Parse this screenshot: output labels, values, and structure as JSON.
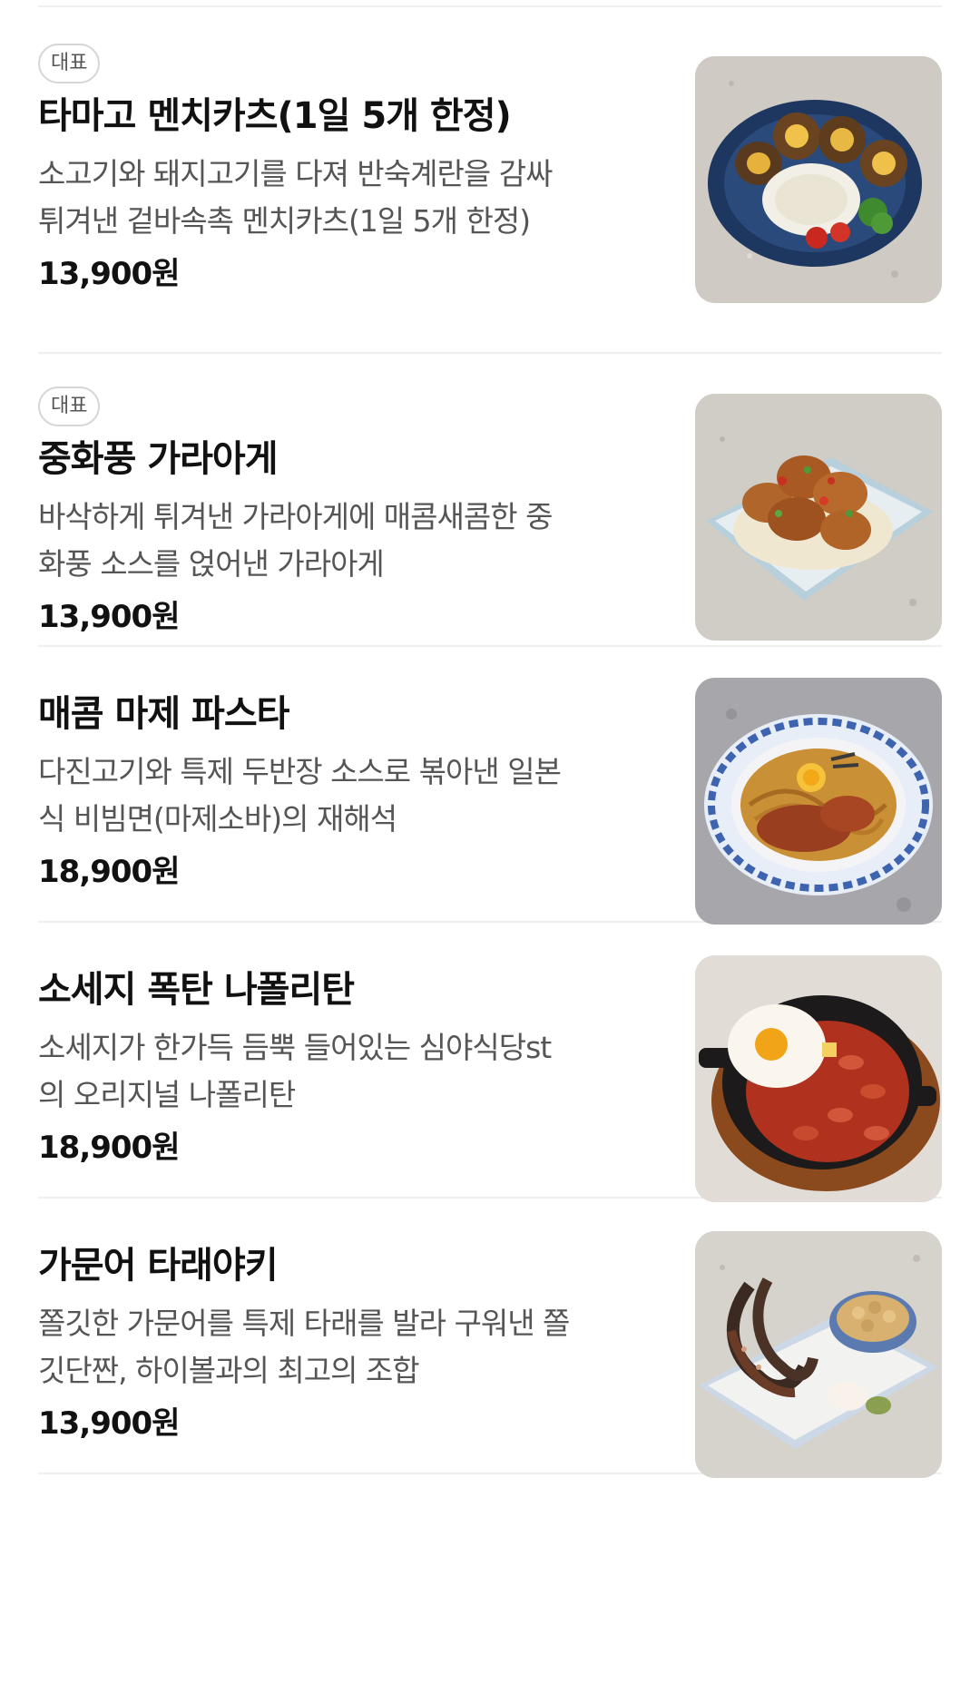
{
  "menu": {
    "items": [
      {
        "badge": "대표",
        "name": "타마고 멘치카츠(1일 5개 한정)",
        "description_lines": [
          "소고기와 돼지고기를 다져 반숙계란을 감싸",
          "튀겨낸 겉바속촉 멘치카츠(1일 5개 한정)"
        ],
        "price": "13,900원",
        "image": "menchi-katsu-photo"
      },
      {
        "badge": "대표",
        "name": "중화풍 가라아게",
        "description_lines": [
          "바삭하게 튀겨낸 가라아게에 매콤새콤한 중",
          "화풍 소스를 얹어낸 가라아게"
        ],
        "price": "13,900원",
        "image": "karaage-photo"
      },
      {
        "badge": "",
        "name": "매콤 마제 파스타",
        "description_lines": [
          "다진고기와 특제 두반장 소스로 볶아낸 일본",
          "식 비빔면(마제소바)의 재해석"
        ],
        "price": "18,900원",
        "image": "maze-pasta-photo"
      },
      {
        "badge": "",
        "name": "소세지 폭탄 나폴리탄",
        "description_lines": [
          "소세지가 한가득 듬뿍 들어있는 심야식당st",
          "의 오리지널 나폴리탄"
        ],
        "price": "18,900원",
        "image": "napolitan-photo"
      },
      {
        "badge": "",
        "name": "가문어 타래야키",
        "description_lines": [
          "쫄깃한 가문어를 특제 타래를 발라 구워낸 쫄",
          "깃단짠, 하이볼과의 최고의 조합"
        ],
        "price": "13,900원",
        "image": "grilled-squid-photo"
      }
    ]
  }
}
